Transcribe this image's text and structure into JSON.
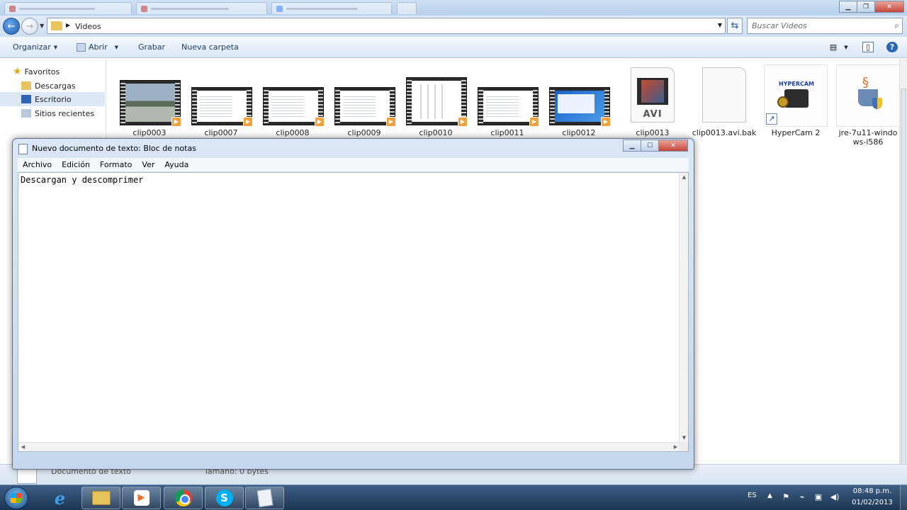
{
  "explorer": {
    "address": {
      "folder": "Videos",
      "search_placeholder": "Buscar Videos"
    },
    "commands": {
      "organizar": "Organizar",
      "abrir": "Abrir",
      "grabar": "Grabar",
      "nueva_carpeta": "Nueva carpeta"
    },
    "nav": {
      "favoritos": "Favoritos",
      "descargas": "Descargas",
      "escritorio": "Escritorio",
      "sitios_recientes": "Sitios recientes"
    },
    "items": [
      {
        "name": "clip0003",
        "kind": "video"
      },
      {
        "name": "clip0007",
        "kind": "video"
      },
      {
        "name": "clip0008",
        "kind": "video"
      },
      {
        "name": "clip0009",
        "kind": "video"
      },
      {
        "name": "clip0010",
        "kind": "video"
      },
      {
        "name": "clip0011",
        "kind": "video"
      },
      {
        "name": "clip0012",
        "kind": "video"
      },
      {
        "name": "clip0013",
        "kind": "avi",
        "badge": "AVI"
      },
      {
        "name": "clip0013.avi.bak",
        "kind": "file"
      },
      {
        "name": "HyperCam 2",
        "kind": "shortcut",
        "logo": "HYPERCAM"
      },
      {
        "name": "jre-7u11-windows-i586",
        "kind": "installer"
      }
    ],
    "details": {
      "name": "Documento de texto",
      "size": "Tamaño: 0 bytes"
    }
  },
  "notepad": {
    "title": "Nuevo documento de texto: Bloc de notas",
    "menu": {
      "archivo": "Archivo",
      "edicion": "Edición",
      "formato": "Formato",
      "ver": "Ver",
      "ayuda": "Ayuda"
    },
    "content": "Descargan y descomprimer"
  },
  "taskbar": {
    "language": "ES",
    "time": "08:48 p.m.",
    "date": "01/02/2013"
  },
  "colors": {
    "accent": "#2a64b4",
    "taskbar": "#1c3553",
    "play_badge": "#f2a03a"
  }
}
